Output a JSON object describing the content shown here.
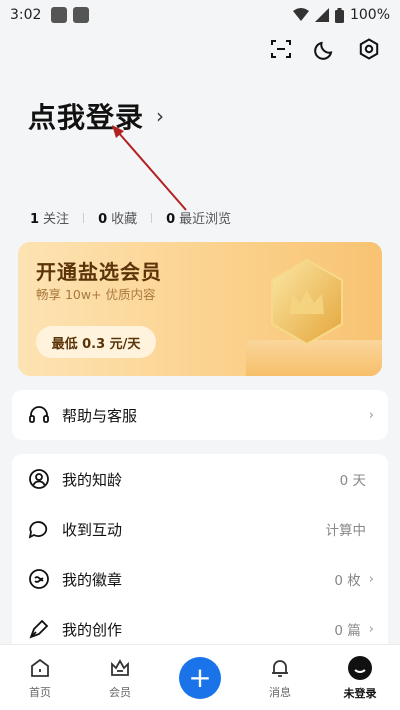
{
  "status": {
    "time": "3:02",
    "battery": "100%"
  },
  "header": {
    "scan_icon": "scan-icon",
    "theme_icon": "moon-icon",
    "settings_icon": "gear-icon"
  },
  "login": {
    "title": "点我登录",
    "chevron": "›"
  },
  "stats": [
    {
      "value": "1",
      "label": "关注"
    },
    {
      "value": "0",
      "label": "收藏"
    },
    {
      "value": "0",
      "label": "最近浏览"
    }
  ],
  "vip": {
    "title": "开通盐选会员",
    "subtitle": "畅享 10w+ 优质内容",
    "price_button": "最低 0.3 元/天"
  },
  "help": {
    "label": "帮助与客服",
    "arrow": "›"
  },
  "menu": [
    {
      "label": "我的知龄",
      "value": "0 天",
      "arrow": "",
      "icon": "user-circle-icon"
    },
    {
      "label": "收到互动",
      "value": "计算中",
      "arrow": "",
      "icon": "chat-icon"
    },
    {
      "label": "我的徽章",
      "value": "0 枚",
      "arrow": "›",
      "icon": "badge-icon"
    },
    {
      "label": "我的创作",
      "value": "0 篇",
      "arrow": "›",
      "icon": "pen-icon"
    }
  ],
  "tabs": [
    {
      "label": "首页",
      "icon": "home-icon"
    },
    {
      "label": "会员",
      "icon": "crown-icon"
    },
    {
      "label": "",
      "icon": "plus-icon"
    },
    {
      "label": "消息",
      "icon": "bell-icon"
    },
    {
      "label": "未登录",
      "icon": "avatar-icon"
    }
  ],
  "colors": {
    "accent": "#1a73e8",
    "vip_gold": "#fbd28e",
    "annotation": "#b22222"
  }
}
